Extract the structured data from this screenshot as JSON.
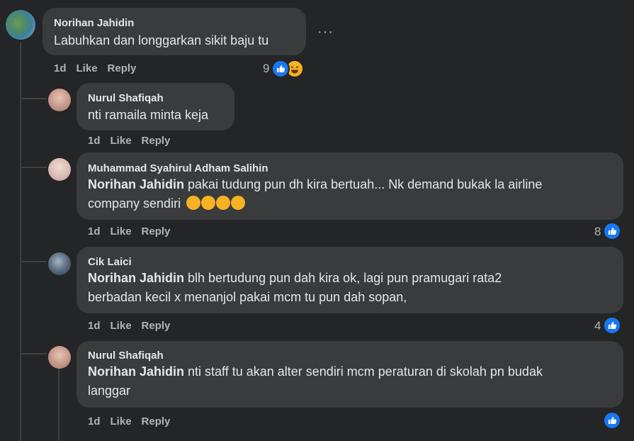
{
  "comments": [
    {
      "author": "Norihan Jahidin",
      "text": "Labuhkan dan longgarkan sikit baju tu",
      "time": "1d",
      "like": "Like",
      "reply": "Reply",
      "reaction_count": "9",
      "more": "···"
    },
    {
      "author": "Nurul Shafiqah",
      "text": "nti ramaila minta keja",
      "time": "1d",
      "like": "Like",
      "reply": "Reply"
    },
    {
      "author": "Muhammad Syahirul Adham Salihin",
      "mention": "Norihan Jahidin",
      "text_line1": " pakai tudung pun dh kira bertuah... Nk demand bukak la airline",
      "text_line2": "company sendiri",
      "time": "1d",
      "like": "Like",
      "reply": "Reply",
      "reaction_count": "8"
    },
    {
      "author": "Cik Laici",
      "mention": "Norihan Jahidin",
      "text_line1": " blh bertudung pun dah kira ok, lagi pun pramugari rata2",
      "text_line2": "berbadan kecil x menanjol pakai mcm tu pun dah sopan,",
      "time": "1d",
      "like": "Like",
      "reply": "Reply",
      "reaction_count": "4"
    },
    {
      "author": "Nurul Shafiqah",
      "mention": "Norihan Jahidin",
      "text_line1": " nti staff tu akan alter sendiri mcm peraturan di skolah pn budak",
      "text_line2": "langgar",
      "time": "1d",
      "like": "Like",
      "reply": "Reply"
    }
  ],
  "colors": {
    "background": "#242526",
    "bubble": "#3a3b3c",
    "like_blue": "#1877f2",
    "haha_yellow": "#f7b125"
  }
}
